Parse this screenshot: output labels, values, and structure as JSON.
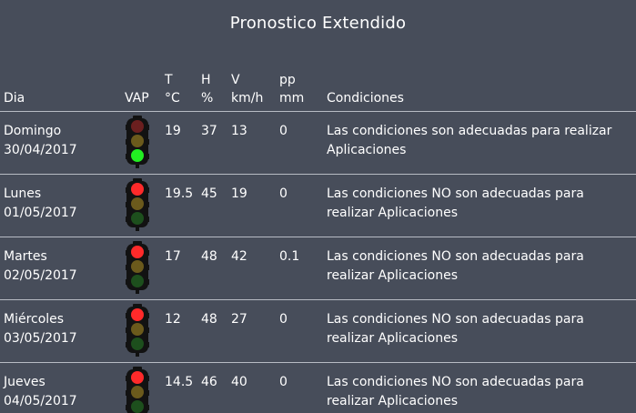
{
  "title": "Pronostico Extendido",
  "headers": {
    "dia": "Dia",
    "vap": "VAP",
    "t_top": "T",
    "t_bottom": "°C",
    "h_top": "H",
    "h_bottom": "%",
    "v_top": "V",
    "v_bottom": "km/h",
    "pp_top": "pp",
    "pp_bottom": "mm",
    "condiciones": "Condiciones"
  },
  "rows": [
    {
      "day": "Domingo",
      "date": "30/04/2017",
      "light": "green",
      "t": "19",
      "h": "37",
      "v": "13",
      "pp": "0",
      "conditions_1": "Las condiciones son adecuadas para realizar",
      "conditions_2": "Aplicaciones"
    },
    {
      "day": "Lunes",
      "date": "01/05/2017",
      "light": "red",
      "t": "19.5",
      "h": "45",
      "v": "19",
      "pp": "0",
      "conditions_1": "Las condiciones NO son adecuadas para",
      "conditions_2": "realizar Aplicaciones"
    },
    {
      "day": "Martes",
      "date": "02/05/2017",
      "light": "red",
      "t": "17",
      "h": "48",
      "v": "42",
      "pp": "0.1",
      "conditions_1": "Las condiciones NO son adecuadas para",
      "conditions_2": "realizar Aplicaciones"
    },
    {
      "day": "Miércoles",
      "date": "03/05/2017",
      "light": "red",
      "t": "12",
      "h": "48",
      "v": "27",
      "pp": "0",
      "conditions_1": "Las condiciones NO son adecuadas para",
      "conditions_2": "realizar Aplicaciones"
    },
    {
      "day": "Jueves",
      "date": "04/05/2017",
      "light": "red",
      "t": "14.5",
      "h": "46",
      "v": "40",
      "pp": "0",
      "conditions_1": "Las condiciones NO son adecuadas para",
      "conditions_2": "realizar Aplicaciones"
    }
  ],
  "colors": {
    "background": "#474d5a",
    "red_on": "#ff2a2a",
    "green_on": "#22ee22",
    "red_off": "#6b1f1f",
    "yellow_off": "#6b5a1c",
    "green_off": "#1d4f1d"
  }
}
